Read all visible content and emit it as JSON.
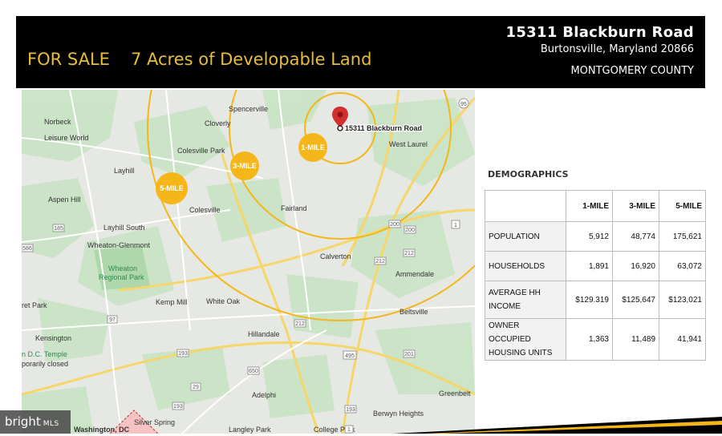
{
  "header": {
    "for_sale": "FOR SALE",
    "headline": "7 Acres of Developable Land",
    "street": "15311 Blackburn Road",
    "city_line": "Burtonsville, Maryland  20866",
    "county": "MONTGOMERY COUNTY"
  },
  "map": {
    "pin_label": "15311 Blackburn Road",
    "rings": [
      "1-MILE",
      "3-MILE",
      "5-MILE"
    ],
    "places": [
      "Norbeck",
      "Leisure World",
      "Spencerville",
      "Cloverly",
      "Colesville Park",
      "West Laurel",
      "Layhill",
      "Aspen Hill",
      "Colesville",
      "Fairland",
      "Layhill South",
      "Wheaton-Glenmont",
      "Calverton",
      "Ammendale",
      "Kemp Mill",
      "White Oak",
      "Beltsville",
      "Kensington",
      "Hillandale",
      "Adelphi",
      "Greenbelt",
      "Silver Spring",
      "Berwyn Heights",
      "Washington, DC",
      "Langley Park",
      "College Park",
      "n D.C. Temple",
      "porarily closed",
      "ret Park"
    ],
    "park_label": [
      "Wheaton",
      "Regional Park"
    ],
    "roads": [
      "95",
      "200",
      "1",
      "200",
      "212",
      "212",
      "212",
      "185",
      "586",
      "97",
      "495",
      "201",
      "650",
      "193",
      "193",
      "29",
      "193",
      "1"
    ]
  },
  "demographics": {
    "title": "DEMOGRAPHICS",
    "columns": [
      "1-MILE",
      "3-MILE",
      "5-MILE"
    ],
    "rows": [
      {
        "label": "POPULATION",
        "values": [
          "5,912",
          "48,774",
          "175,621"
        ]
      },
      {
        "label": "HOUSEHOLDS",
        "values": [
          "1,891",
          "16,920",
          "63,072"
        ]
      },
      {
        "label": "AVERAGE HH INCOME",
        "values": [
          "$129.319",
          "$125,647",
          "$123,021"
        ]
      },
      {
        "label": "OWNER OCCUPIED HOUSING UNITS",
        "values": [
          "1,363",
          "11,489",
          "41,941"
        ]
      }
    ]
  },
  "watermark": {
    "brand": "bright",
    "suffix": "MLS"
  },
  "colors": {
    "accent": "#e8bd3a",
    "ring": "#f4b619",
    "banner": "#000000",
    "pin": "#d32f2f"
  }
}
